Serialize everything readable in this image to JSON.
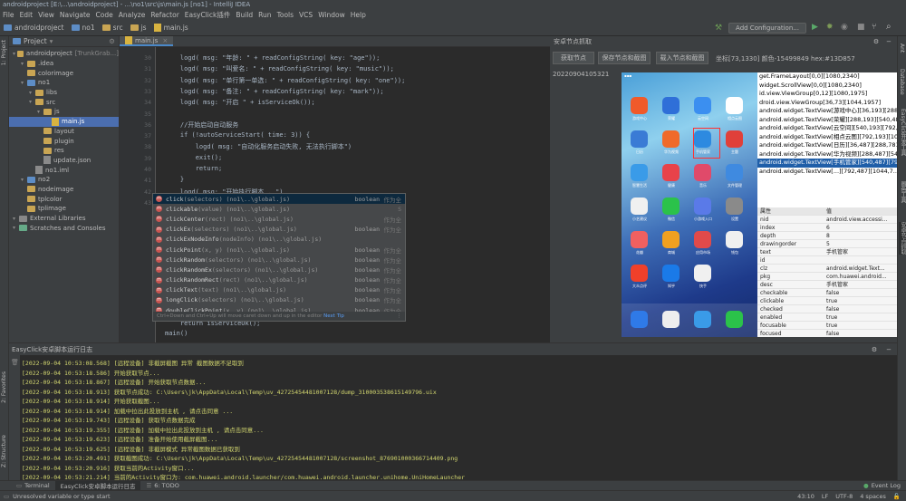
{
  "window_title": "androidproject [E:\\...\\androidproject] - ...\\no1\\src\\js\\main.js [no1] - IntelliJ IDEA",
  "menu": [
    "File",
    "Edit",
    "View",
    "Navigate",
    "Code",
    "Analyze",
    "Refactor",
    "EasyClick插件",
    "Build",
    "Run",
    "Tools",
    "VCS",
    "Window",
    "Help"
  ],
  "breadcrumb": [
    "androidproject",
    "no1",
    "src",
    "js",
    "main.js"
  ],
  "run_config": "Add Configuration...",
  "project_panel": {
    "title": "Project",
    "items": [
      {
        "label": "androidproject",
        "suffix": "[TrunkGrab...]",
        "depth": 0,
        "type": "folder"
      },
      {
        "label": ".idea",
        "depth": 1,
        "type": "folder"
      },
      {
        "label": "colorimage",
        "depth": 1,
        "type": "folder"
      },
      {
        "label": "no1",
        "depth": 1,
        "type": "module"
      },
      {
        "label": "libs",
        "depth": 2,
        "type": "folder"
      },
      {
        "label": "src",
        "depth": 2,
        "type": "folder"
      },
      {
        "label": "js",
        "depth": 3,
        "type": "folder"
      },
      {
        "label": "main.js",
        "depth": 4,
        "type": "js",
        "selected": true
      },
      {
        "label": "layout",
        "depth": 3,
        "type": "folder"
      },
      {
        "label": "plugin",
        "depth": 3,
        "type": "folder"
      },
      {
        "label": "res",
        "depth": 3,
        "type": "folder"
      },
      {
        "label": "update.json",
        "depth": 3,
        "type": "file"
      },
      {
        "label": "no1.iml",
        "depth": 2,
        "type": "file"
      },
      {
        "label": "no2",
        "depth": 1,
        "type": "module"
      },
      {
        "label": "nodeimage",
        "depth": 1,
        "type": "folder"
      },
      {
        "label": "tplcolor",
        "depth": 1,
        "type": "folder"
      },
      {
        "label": "tplimage",
        "depth": 1,
        "type": "folder"
      },
      {
        "label": "External Libraries",
        "depth": 0,
        "type": "lib"
      },
      {
        "label": "Scratches and Consoles",
        "depth": 0,
        "type": "scratch"
      }
    ]
  },
  "editor": {
    "tab": "main.js",
    "line_numbers": [
      "30",
      "31",
      "32",
      "33",
      "34",
      "35",
      "36",
      "37",
      "38",
      "39",
      "40",
      "41",
      "42",
      "43",
      "",
      "",
      "",
      "",
      "",
      "",
      "",
      "",
      "",
      "",
      "",
      "",
      "",
      "",
      "",
      ""
    ],
    "lines": [
      {
        "n": "30",
        "t": "    logd( msg: \"年龄: \" + readConfigString( key: \"age\"));"
      },
      {
        "n": "31",
        "t": "    logd( msg: \"叫爱名: \" + readConfigString( key: \"music\"));"
      },
      {
        "n": "32",
        "t": "    logd( msg: \"单行第一单选: \" + readConfigString( key: \"one\"));"
      },
      {
        "n": "33",
        "t": "    logd( msg: \"备注: \" + readConfigString( key: \"mark\"));"
      },
      {
        "n": "34",
        "t": "    logd( msg: \"开启 \" + isServiceOk());"
      },
      {
        "n": "35",
        "t": ""
      },
      {
        "n": "36",
        "t": "    //开始启动自动服务"
      },
      {
        "n": "37",
        "t": "    if (!autoServiceStart( time: 3)) {"
      },
      {
        "n": "38",
        "t": "        logd( msg: \"自动化服务启动失败, 无法执行脚本\")"
      },
      {
        "n": "39",
        "t": "        exit();"
      },
      {
        "n": "40",
        "t": "        return;"
      },
      {
        "n": "41",
        "t": "    }"
      },
      {
        "n": "42",
        "t": "    logd( msg: \"开始执行脚本...\")"
      },
      {
        "n": "43",
        "t": "    home();"
      },
      {
        "n": "",
        "t": "    click"
      }
    ],
    "tail_lines": [
      "    return isServiceOk();",
      "main()"
    ]
  },
  "completion": {
    "typed": "click",
    "items": [
      {
        "name": "click",
        "params": "(selectors) (no1\\..\\global.js)",
        "type": "boolean",
        "mod": "作为全"
      },
      {
        "name": "clickable",
        "params": "(value) (no1\\..\\global.js)",
        "type": "",
        "mod": "S"
      },
      {
        "name": "clickCenter",
        "params": "(rect) (no1\\..\\global.js)",
        "type": "",
        "mod": "作为全"
      },
      {
        "name": "clickEx",
        "params": "(selectors) (no1\\..\\global.js)",
        "type": "boolean",
        "mod": "作为全"
      },
      {
        "name": "clickExNodeInfo",
        "params": "(nodeInfo) (no1\\..\\global.js)",
        "type": "",
        "mod": ""
      },
      {
        "name": "clickPoint",
        "params": "(x, y) (no1\\..\\global.js)",
        "type": "boolean",
        "mod": "作为全"
      },
      {
        "name": "clickRandom",
        "params": "(selectors) (no1\\..\\global.js)",
        "type": "boolean",
        "mod": "作为全"
      },
      {
        "name": "clickRandomEx",
        "params": "(selectors) (no1\\..\\global.js)",
        "type": "boolean",
        "mod": "作为全"
      },
      {
        "name": "clickRandomRect",
        "params": "(rect) (no1\\..\\global.js)",
        "type": "boolean",
        "mod": "作为全"
      },
      {
        "name": "clickText",
        "params": "(text) (no1\\..\\global.js)",
        "type": "boolean",
        "mod": "作为全"
      },
      {
        "name": "longClick",
        "params": "(selectors) (no1\\..\\global.js)",
        "type": "boolean",
        "mod": "作为全"
      },
      {
        "name": "doubleClickPoint",
        "params": "(x, y) (no1\\..\\global.js)",
        "type": "boolean",
        "mod": "作为全"
      }
    ],
    "hint": "Ctrl+Down and Ctrl+Up will move caret down and up in the editor",
    "hint_link": "Next Tip"
  },
  "node_panel": {
    "title": "安卓节点抓取",
    "buttons": [
      "获取节点",
      "保存节点和截图",
      "载入节点和截图"
    ],
    "coords": "坐标[73,1330] 颜色-15499849 hex:#13D857",
    "timestamp": "20220904105321",
    "hierarchy": [
      "get.FrameLayout[0,0][1080,2340]",
      "widget.ScrollView[0,0][1080,2340]",
      "id.view.ViewGroup[0,12][1080,1975]",
      "droid.view.ViewGroup[36,73][1044,1957]",
      "android.widget.TextView[游戏中心][36,193][288,...",
      "android.widget.TextView[荣耀][288,193][540,48...",
      "android.widget.TextView[云空间][540,193][792,...",
      "android.widget.TextView[相点云图][792,193][10...",
      "android.widget.TextView[日历][36,487][288,781...",
      "android.widget.TextView[华为视频][288,487][54...",
      "android.widget.TextView[手机管家][540,487][79...",
      "android.widget.TextView[...][792,487][1044,7..."
    ],
    "hierarchy_selected": 10,
    "props_header": [
      "属性",
      "值"
    ],
    "props": [
      [
        "nid",
        "android.view.accessi..."
      ],
      [
        "index",
        "6"
      ],
      [
        "depth",
        "8"
      ],
      [
        "drawingorder",
        "5"
      ],
      [
        "text",
        "手机管家"
      ],
      [
        "id",
        ""
      ],
      [
        "clz",
        "android.widget.Text..."
      ],
      [
        "pkg",
        "com.huawei.android..."
      ],
      [
        "desc",
        "手机管家"
      ],
      [
        "checkable",
        "false"
      ],
      [
        "clickable",
        "true"
      ],
      [
        "checked",
        "false"
      ],
      [
        "enabled",
        "true"
      ],
      [
        "focusable",
        "true"
      ],
      [
        "focused",
        "false"
      ]
    ],
    "apps": [
      {
        "label": "游戏中心",
        "color": "#f05a2a"
      },
      {
        "label": "荣耀",
        "color": "#2f6fd8"
      },
      {
        "label": "云空间",
        "color": "#3b8ff0"
      },
      {
        "label": "相点云图",
        "color": "#ffffff"
      },
      {
        "label": "日历",
        "color": "#3a7bd5"
      },
      {
        "label": "华为视频",
        "color": "#f06a2a"
      },
      {
        "label": "手机管家",
        "color": "#2d8ae0"
      },
      {
        "label": "主题",
        "color": "#e0403a"
      },
      {
        "label": "智慧生活",
        "color": "#3a9be8"
      },
      {
        "label": "健康",
        "color": "#e8424a"
      },
      {
        "label": "音乐",
        "color": "#e04a6a"
      },
      {
        "label": "文件管理",
        "color": "#3f8ae0"
      },
      {
        "label": "小艺建议",
        "color": "#f0f0f0"
      },
      {
        "label": "微信",
        "color": "#2bc24a"
      },
      {
        "label": "小游戏入口",
        "color": "#5a7ae8"
      },
      {
        "label": "设置",
        "color": "#8a8a8a"
      },
      {
        "label": "花瓣",
        "color": "#f06060"
      },
      {
        "label": "商城",
        "color": "#f0a020"
      },
      {
        "label": "应用市场",
        "color": "#e04a4a"
      },
      {
        "label": "钱包",
        "color": "#f0f0f0"
      },
      {
        "label": "大众点评",
        "color": "#f0402a"
      },
      {
        "label": "知乎",
        "color": "#1a7ae8"
      },
      {
        "label": "快手",
        "color": "#f0f0f0"
      },
      {
        "label": "",
        "color": "#00000000"
      }
    ],
    "dock": [
      {
        "label": "信息",
        "color": "#2f7ae8"
      },
      {
        "label": "相机",
        "color": "#eeeeee"
      },
      {
        "label": "浏览器",
        "color": "#3a9be8"
      },
      {
        "label": "电话",
        "color": "#2bc24a"
      }
    ]
  },
  "log_panel": {
    "title": "EasyClick安卓脚本运行日志",
    "lines": [
      "[2022-09-04 10:53:08.568] [远程设备] 非截屏截图  异常 截图数据不足取到",
      "[2022-09-04 10:53:18.586] 开始获取节点...",
      "[2022-09-04 10:53:18.867] [远程设备] 开始获取节点数据...",
      "[2022-09-04 10:53:18.913] 获取节点成功: C:\\Users\\jk\\AppData\\Local\\Temp\\uv_42725454481007128/dump_310003538615149796.uix",
      "[2022-09-04 10:53:18.914] 开始获取截图...",
      "[2022-09-04 10:53:18.914] 加载中拉出此投放到主机 , 请点击同意 ...",
      "[2022-09-04 10:53:19.743] [远程设备] 获取节点数据完成",
      "[2022-09-04 10:53:19.355] [远程设备] 加载中拉出此投放到主机 , 请点击同意...",
      "[2022-09-04 10:53:19.623] [远程设备] 准备开始使用截屏截图...",
      "[2022-09-04 10:53:19.625] [远程设备] 非截屏模式  异常截图数据已获取到",
      "[2022-09-04 10:53:20.491] 获取截图成功: C:\\Users\\jk\\AppData\\Local\\Temp\\uv_42725454481007128/screenshot_876901000366714409.png",
      "[2022-09-04 10:53:20.916] 获取当前的Activity窗口...",
      "[2022-09-04 10:53:21.214] 当前的Activity窗口为: com.huawei.android.launcher/com.huawei.android.launcher.unihome.UniHomeLauncher"
    ]
  },
  "bottom_tabs": [
    "Terminal",
    "EasyClick安卓脚本运行日志",
    "6: TODO"
  ],
  "event_log": "Event Log",
  "status": {
    "message": "Unresolved variable or type start",
    "position": "43:10",
    "line_sep": "LF",
    "encoding": "UTF-8",
    "indent": "4 spaces"
  },
  "left_strip": [
    "1: Project",
    "2: Favorites",
    "Z: Structure"
  ],
  "right_strip": [
    "Ant",
    "Database",
    "EasyClick开发工具",
    "图色工具",
    "安卓节点抓取"
  ]
}
